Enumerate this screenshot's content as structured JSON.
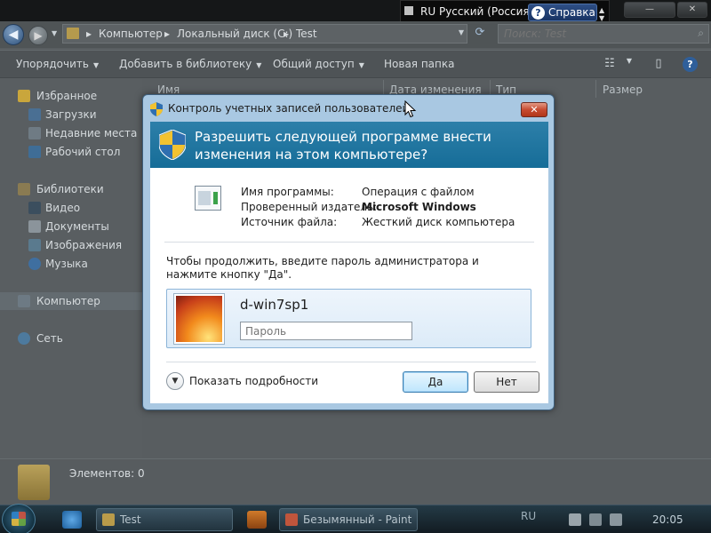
{
  "language_bar": {
    "lang_code": "RU",
    "lang_name": "Русский (Россия)",
    "help_label": "Справка"
  },
  "explorer": {
    "address": {
      "crumbs": [
        "Компьютер",
        "Локальный диск (C:)",
        "Test"
      ],
      "search_placeholder": "Поиск: Test"
    },
    "toolbar": {
      "organize": "Упорядочить",
      "add_to_library": "Добавить в библиотеку",
      "share": "Общий доступ",
      "new_folder": "Новая папка"
    },
    "nav": {
      "favorites": "Избранное",
      "downloads": "Загрузки",
      "recent": "Недавние места",
      "desktop": "Рабочий стол",
      "libraries": "Библиотеки",
      "video": "Видео",
      "documents": "Документы",
      "images": "Изображения",
      "music": "Музыка",
      "computer": "Компьютер",
      "network": "Сеть"
    },
    "columns": {
      "name": "Имя",
      "date_modified": "Дата изменения",
      "type": "Тип",
      "size": "Размер"
    },
    "status": {
      "item_count": "Элементов: 0"
    }
  },
  "uac": {
    "title": "Контроль учетных записей пользователей",
    "question": "Разрешить следующей программе внести изменения на этом компьютере?",
    "program_name_label": "Имя программы:",
    "program_name_value": "Операция с файлом",
    "publisher_label": "Проверенный издатель:",
    "publisher_value": "Microsoft Windows",
    "source_label": "Источник файла:",
    "source_value": "Жесткий диск компьютера",
    "prompt": "Чтобы продолжить, введите пароль администратора и нажмите кнопку \"Да\".",
    "username": "d-win7sp1",
    "password_placeholder": "Пароль",
    "show_details": "Показать подробности",
    "yes_button": "Да",
    "no_button": "Нет"
  },
  "taskbar": {
    "explorer_task": "Test",
    "paint_task": "Безымянный - Paint",
    "tray_lang": "RU",
    "clock": "20:05"
  },
  "colors": {
    "uac_header": "#166d98",
    "uac_frame": "#a9c8e2",
    "close_button": "#c74b31"
  }
}
